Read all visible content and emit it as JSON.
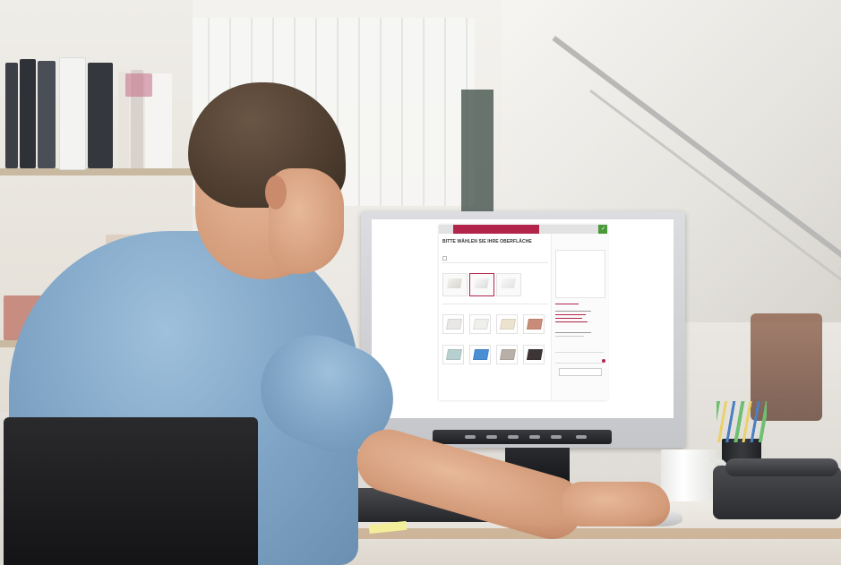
{
  "scene": {
    "description_subject": "man at desk using computer",
    "screen_site": {
      "step_label": "",
      "headline": "BITTE WÄHLEN SIE IHRE OBERFLÄCHE",
      "subline": "",
      "checkbox_label": "",
      "section1_label": "",
      "section2_label": "",
      "variants": [
        "",
        "",
        ""
      ],
      "colors": [
        {
          "label": "",
          "color": "#e9e8e6"
        },
        {
          "label": "",
          "color": "#efefec"
        },
        {
          "label": "",
          "color": "#ece3cf"
        },
        {
          "label": "",
          "color": "#c98c78"
        },
        {
          "label": "",
          "color": "#b7d0cf"
        },
        {
          "label": "",
          "color": "#4a8fd3"
        },
        {
          "label": "",
          "color": "#b8b0a8"
        },
        {
          "label": "",
          "color": "#3c3435"
        }
      ],
      "sidebar_title": "",
      "sidebar_button": ""
    },
    "colors": {
      "accent_magenta": "#b3244a",
      "accent_green": "#4a9a3b"
    }
  }
}
